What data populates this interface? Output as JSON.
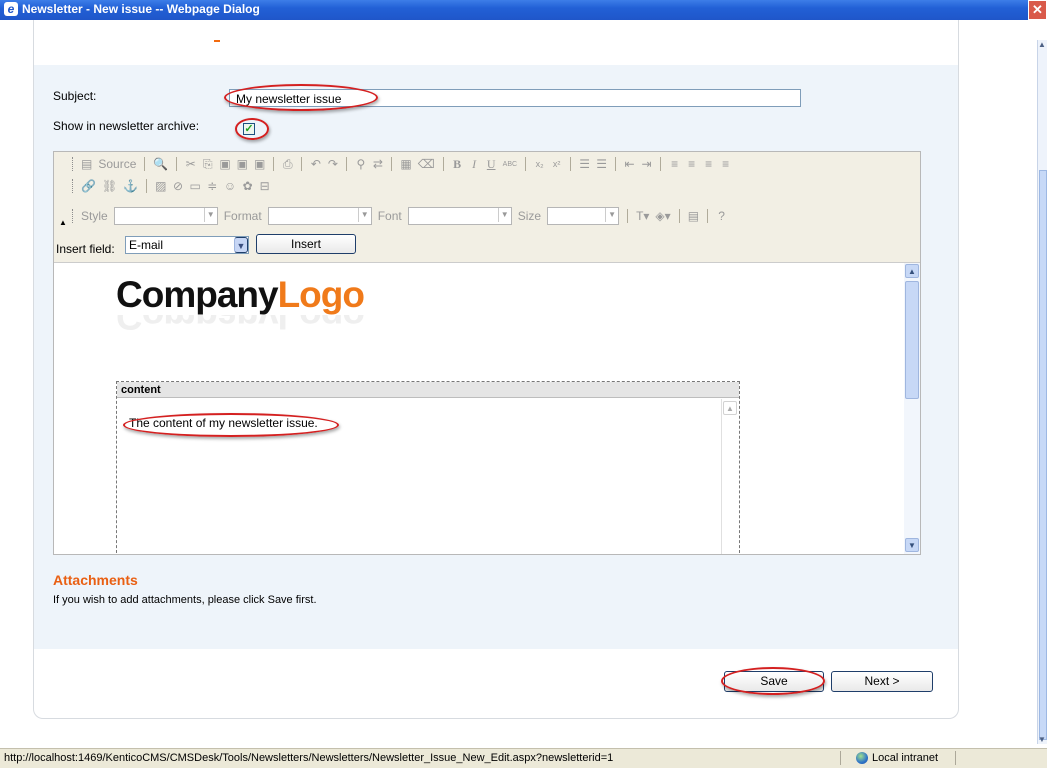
{
  "window": {
    "title": "Newsletter - New issue -- Webpage Dialog",
    "close_symbol": "✕",
    "icon": "ie-icon"
  },
  "form": {
    "subject_label": "Subject:",
    "subject_value": "My newsletter issue",
    "archive_label": "Show in newsletter archive:",
    "archive_checked": true
  },
  "toolbar": {
    "source_label": "Source",
    "style_label": "Style",
    "format_label": "Format",
    "font_label": "Font",
    "size_label": "Size"
  },
  "insert_field": {
    "label": "Insert field:",
    "selected": "E-mail",
    "button_label": "Insert"
  },
  "document": {
    "logo_dark": "Company",
    "logo_orange": "Logo",
    "content_header": "content",
    "content_text": "The content of my newsletter issue."
  },
  "attachments": {
    "title": "Attachments",
    "text": "If you wish to add attachments, please click Save first."
  },
  "buttons": {
    "save": "Save",
    "next": "Next >"
  },
  "status": {
    "url": "http://localhost:1469/KenticoCMS/CMSDesk/Tools/Newsletters/Newsletters/Newsletter_Issue_New_Edit.aspx?newsletterid=1",
    "zone": "Local intranet"
  },
  "colors": {
    "title_bar": "#2260d6",
    "accent_orange": "#e95f12",
    "highlight_oval": "#d42020",
    "panel_background": "#eef4fa"
  }
}
